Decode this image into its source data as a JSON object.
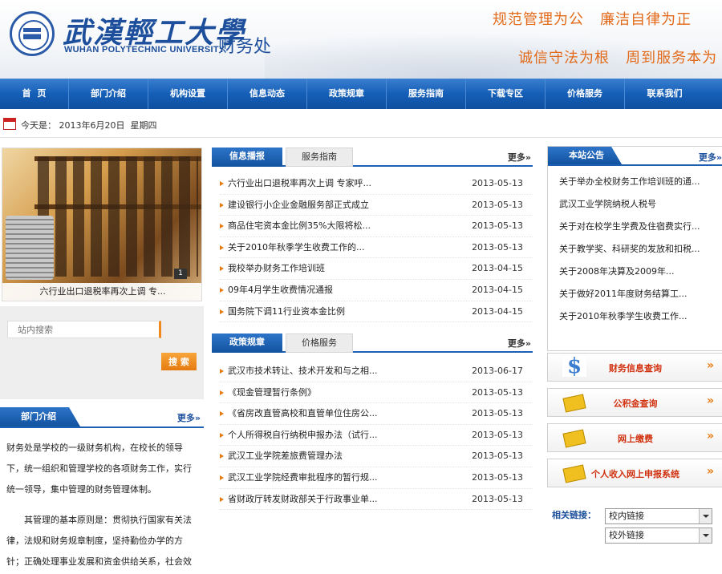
{
  "header": {
    "university_cn": "武漢輕工大學",
    "university_en": "WUHAN POLYTECHNIC UNIVERSITY",
    "department": "财务处",
    "slogan_1": "规范管理为公   廉洁自律为正",
    "slogan_2": "诚信守法为根   周到服务本为",
    "accent_color": "#1d5fb3",
    "slogan_color": "#e26a1a"
  },
  "nav": {
    "items": [
      "首  页",
      "部门介绍",
      "机构设置",
      "信息动态",
      "政策规章",
      "服务指南",
      "下载专区",
      "价格服务",
      "联系我们"
    ]
  },
  "datebar": {
    "label": "今天是：",
    "date": "2013年6月20日  星期四"
  },
  "slideshow": {
    "caption": "六行业出口退税率再次上调 专...",
    "pager": "1"
  },
  "search": {
    "placeholder": "站内搜索",
    "button_label": "搜 索"
  },
  "intro": {
    "title": "部门介绍",
    "more": "更多»",
    "paragraph_1": "财务处是学校的一级财务机构，在校长的领导下，统一组织和管理学校的各项财务工作，实行统一领导，集中管理的财务管理体制。",
    "paragraph_2": "其管理的基本原则是：贯彻执行国家有关法律，法规和财务规章制度，坚持勤俭办学的方针；正确处理事业发展和资金供给关系，社会效"
  },
  "news_panel_1": {
    "active_tab": "信息播报",
    "inactive_tab": "服务指南",
    "more": "更多»",
    "items": [
      {
        "title": "六行业出口退税率再次上调 专家呼...",
        "date": "2013-05-13"
      },
      {
        "title": "建设银行小企业金融服务部正式成立",
        "date": "2013-05-13"
      },
      {
        "title": "商品住宅资本金比例35%大限将松...",
        "date": "2013-05-13"
      },
      {
        "title": "关于2010年秋季学生收费工作的...",
        "date": "2013-05-13"
      },
      {
        "title": "我校举办财务工作培训班",
        "date": "2013-04-15"
      },
      {
        "title": "09年4月学生收费情况通报",
        "date": "2013-04-15"
      },
      {
        "title": "国务院下调11行业资本金比例",
        "date": "2013-04-15"
      }
    ]
  },
  "news_panel_2": {
    "active_tab": "政策规章",
    "inactive_tab": "价格服务",
    "more": "更多»",
    "items": [
      {
        "title": "武汉市技术转让、技术开发和与之相...",
        "date": "2013-06-17"
      },
      {
        "title": "《现金管理暂行条例》",
        "date": "2013-05-13"
      },
      {
        "title": "《省房改直管高校和直管单位住房公...",
        "date": "2013-05-13"
      },
      {
        "title": "个人所得税自行纳税申报办法（试行...",
        "date": "2013-05-13"
      },
      {
        "title": "武汉工业学院差旅费管理办法",
        "date": "2013-05-13"
      },
      {
        "title": "武汉工业学院经费审批程序的暂行规...",
        "date": "2013-05-13"
      },
      {
        "title": "省财政厅转发财政部关于行政事业单...",
        "date": "2013-05-13"
      }
    ]
  },
  "notice": {
    "title": "本站公告",
    "more": "更多»",
    "items": [
      "关于举办全校财务工作培训班的通...",
      "武汉工业学院纳税人税号",
      "关于对在校学生学费及住宿费实行...",
      "关于教学奖、科研奖的发放和扣税...",
      "关于2008年决算及2009年...",
      "关于做好2011年度财务结算工...",
      "关于2010年秋季学生收费工作..."
    ]
  },
  "services": [
    {
      "label": "财务信息查询",
      "icon": "dollar-icon"
    },
    {
      "label": "公积金查询",
      "icon": "card-icon"
    },
    {
      "label": "网上缴费",
      "icon": "card-icon"
    },
    {
      "label": "个人收入网上申报系统",
      "icon": "card-icon"
    }
  ],
  "service_arrow": "»",
  "links": {
    "label": "相关链接：",
    "select_1": "校内链接",
    "select_2": "校外链接"
  }
}
